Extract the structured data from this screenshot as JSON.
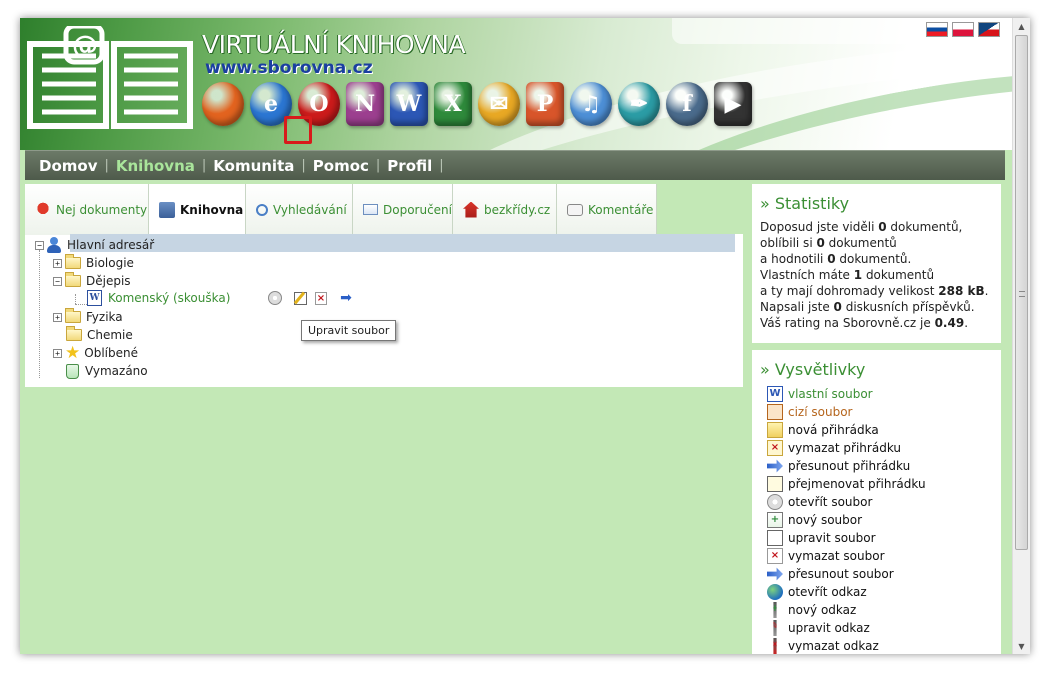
{
  "header": {
    "title": "VIRTUÁLNÍ KNIHOVNA",
    "url": "www.sborovna.cz",
    "app_icons": [
      {
        "name": "firefox-icon",
        "color": "#e2631f",
        "glyph": ""
      },
      {
        "name": "internet-explorer-icon",
        "color": "#2b76d2",
        "glyph": "e"
      },
      {
        "name": "opera-icon",
        "color": "#cc1b1b",
        "glyph": "O"
      },
      {
        "name": "onenote-icon",
        "color": "#9c3f8f",
        "glyph": "N"
      },
      {
        "name": "word-icon",
        "color": "#2c57b5",
        "glyph": "W"
      },
      {
        "name": "excel-icon",
        "color": "#2e8a3b",
        "glyph": "X"
      },
      {
        "name": "outlook-icon",
        "color": "#e8a824",
        "glyph": "✉"
      },
      {
        "name": "powerpoint-icon",
        "color": "#d8552a",
        "glyph": "P"
      },
      {
        "name": "itunes-icon",
        "color": "#4d8fd6",
        "glyph": "♫"
      },
      {
        "name": "publisher-icon",
        "color": "#2b9ca5",
        "glyph": "✒"
      },
      {
        "name": "flash-icon",
        "color": "#4a6b8c",
        "glyph": "f"
      },
      {
        "name": "avi-video-icon",
        "color": "#333333",
        "glyph": "▶"
      }
    ]
  },
  "nav": {
    "items": [
      {
        "label": "Domov",
        "active": false
      },
      {
        "label": "Knihovna",
        "active": true
      },
      {
        "label": "Komunita",
        "active": false
      },
      {
        "label": "Pomoc",
        "active": false
      },
      {
        "label": "Profil",
        "active": false
      }
    ]
  },
  "tabs": [
    {
      "label": "Nej dokumenty",
      "icon": "award-icon",
      "active": false
    },
    {
      "label": "Knihovna",
      "icon": "library-icon",
      "active": true
    },
    {
      "label": "Vyhledávání",
      "icon": "magnifier-icon",
      "active": false
    },
    {
      "label": "Doporučení",
      "icon": "envelope-icon",
      "active": false
    },
    {
      "label": "bezkřídy.cz",
      "icon": "house-icon",
      "active": false
    },
    {
      "label": "Komentáře",
      "icon": "comments-icon",
      "active": false
    }
  ],
  "tree": {
    "root": "Hlavní adresář",
    "folders": [
      "Biologie",
      "Dějepis",
      "Fyzika",
      "Chemie",
      "Oblíbené",
      "Vymazáno"
    ],
    "file": "Komenský (skouška)",
    "tooltip": "Upravit soubor"
  },
  "stats": {
    "title": "» Statistiky",
    "line1_pre": "Doposud jste viděli ",
    "line1_num": "0",
    "line1_post": " dokumentů,",
    "line2_pre": "oblíbili si ",
    "line2_num": "0",
    "line2_post": " dokumentů",
    "line3_pre": "a hodnotili ",
    "line3_num": "0",
    "line3_post": " dokumentů.",
    "line4_pre": "Vlastních máte ",
    "line4_num": "1",
    "line4_post": " dokumentů",
    "line5_pre": "a ty mají dohromady velikost ",
    "line5_num": "288 kB",
    "line5_post": ".",
    "line6_pre": "Napsali jste ",
    "line6_num": "0",
    "line6_post": " diskusních příspěvků.",
    "line7_pre": "Váš rating na Sborovně.cz je ",
    "line7_num": "0.49",
    "line7_post": "."
  },
  "legend": {
    "title": "» Vysvětlivky",
    "items": [
      {
        "label": "vlastní soubor",
        "icon": "own-file-icon",
        "color": "#3b8f34"
      },
      {
        "label": "cizí soubor",
        "icon": "foreign-file-icon",
        "color": "#b5651d"
      },
      {
        "label": "nová přihrádka",
        "icon": "new-folder-icon",
        "color": "#111111"
      },
      {
        "label": "vymazat přihrádku",
        "icon": "delete-folder-icon",
        "color": "#111111"
      },
      {
        "label": "přesunout přihrádku",
        "icon": "move-folder-icon",
        "color": "#111111"
      },
      {
        "label": "přejmenovat přihrádku",
        "icon": "rename-folder-icon",
        "color": "#111111"
      },
      {
        "label": "otevřít soubor",
        "icon": "open-file-icon",
        "color": "#111111"
      },
      {
        "label": "nový soubor",
        "icon": "new-file-icon",
        "color": "#111111"
      },
      {
        "label": "upravit soubor",
        "icon": "edit-file-icon",
        "color": "#111111"
      },
      {
        "label": "vymazat soubor",
        "icon": "delete-file-icon",
        "color": "#111111"
      },
      {
        "label": "přesunout soubor",
        "icon": "move-file-icon",
        "color": "#111111"
      },
      {
        "label": "otevřít odkaz",
        "icon": "open-link-icon",
        "color": "#111111"
      },
      {
        "label": "nový odkaz",
        "icon": "new-link-icon",
        "color": "#111111"
      },
      {
        "label": "upravit odkaz",
        "icon": "edit-link-icon",
        "color": "#111111"
      },
      {
        "label": "vymazat odkaz",
        "icon": "delete-link-icon",
        "color": "#111111"
      }
    ]
  },
  "colors": {
    "accent_green": "#3b8f34",
    "page_bg": "#c3e8b6",
    "selected_row": "#c6d5e3",
    "highlight_red": "#d81b1b"
  }
}
